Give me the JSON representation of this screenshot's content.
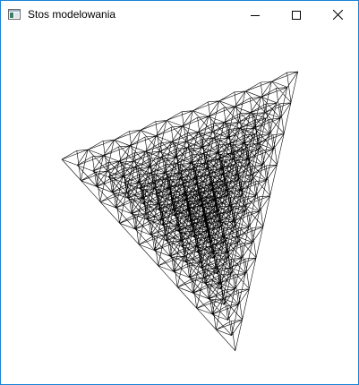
{
  "window": {
    "title": "Stos modelowania",
    "app_icon": "app-window-icon",
    "controls": [
      {
        "name": "minimize",
        "icon": "minimize-icon"
      },
      {
        "name": "maximize",
        "icon": "maximize-icon"
      },
      {
        "name": "close",
        "icon": "close-icon"
      }
    ]
  },
  "canvas": {
    "background": "#ffffff",
    "stroke": "#000000",
    "content": "wireframe pyramid lattice"
  },
  "colors": {
    "border": "#1883d7",
    "titlebar": "#ffffff"
  }
}
